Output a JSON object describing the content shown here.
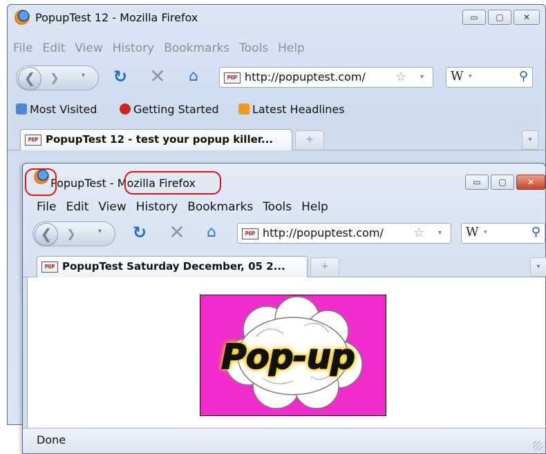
{
  "back_window": {
    "title": "PopupTest 12 - Mozilla Firefox",
    "menu": [
      "File",
      "Edit",
      "View",
      "History",
      "Bookmarks",
      "Tools",
      "Help"
    ],
    "url": "http://popuptest.com/",
    "search_engine": "W",
    "bookmarks": [
      "Most Visited",
      "Getting Started",
      "Latest Headlines"
    ],
    "tab_title": "PopupTest 12 - test your popup killer...",
    "new_tab": "+"
  },
  "front_window": {
    "title_app": "PopupTest",
    "title_sep": " - ",
    "title_browser": "Mozilla Firefox",
    "menu": [
      "File",
      "Edit",
      "View",
      "History",
      "Bookmarks",
      "Tools",
      "Help"
    ],
    "url": "http://popuptest.com/",
    "search_engine": "W",
    "tab_title": "PopupTest Saturday December, 05 2...",
    "new_tab": "+",
    "image_text": "Pop-up",
    "status": "Done"
  },
  "caption_buttons": {
    "minimize": "▭",
    "maximize": "▢",
    "close": "✕"
  },
  "favicon_text": "POP",
  "colors": {
    "popup_bg": "#f22ccc",
    "annotation": "#e01010"
  }
}
